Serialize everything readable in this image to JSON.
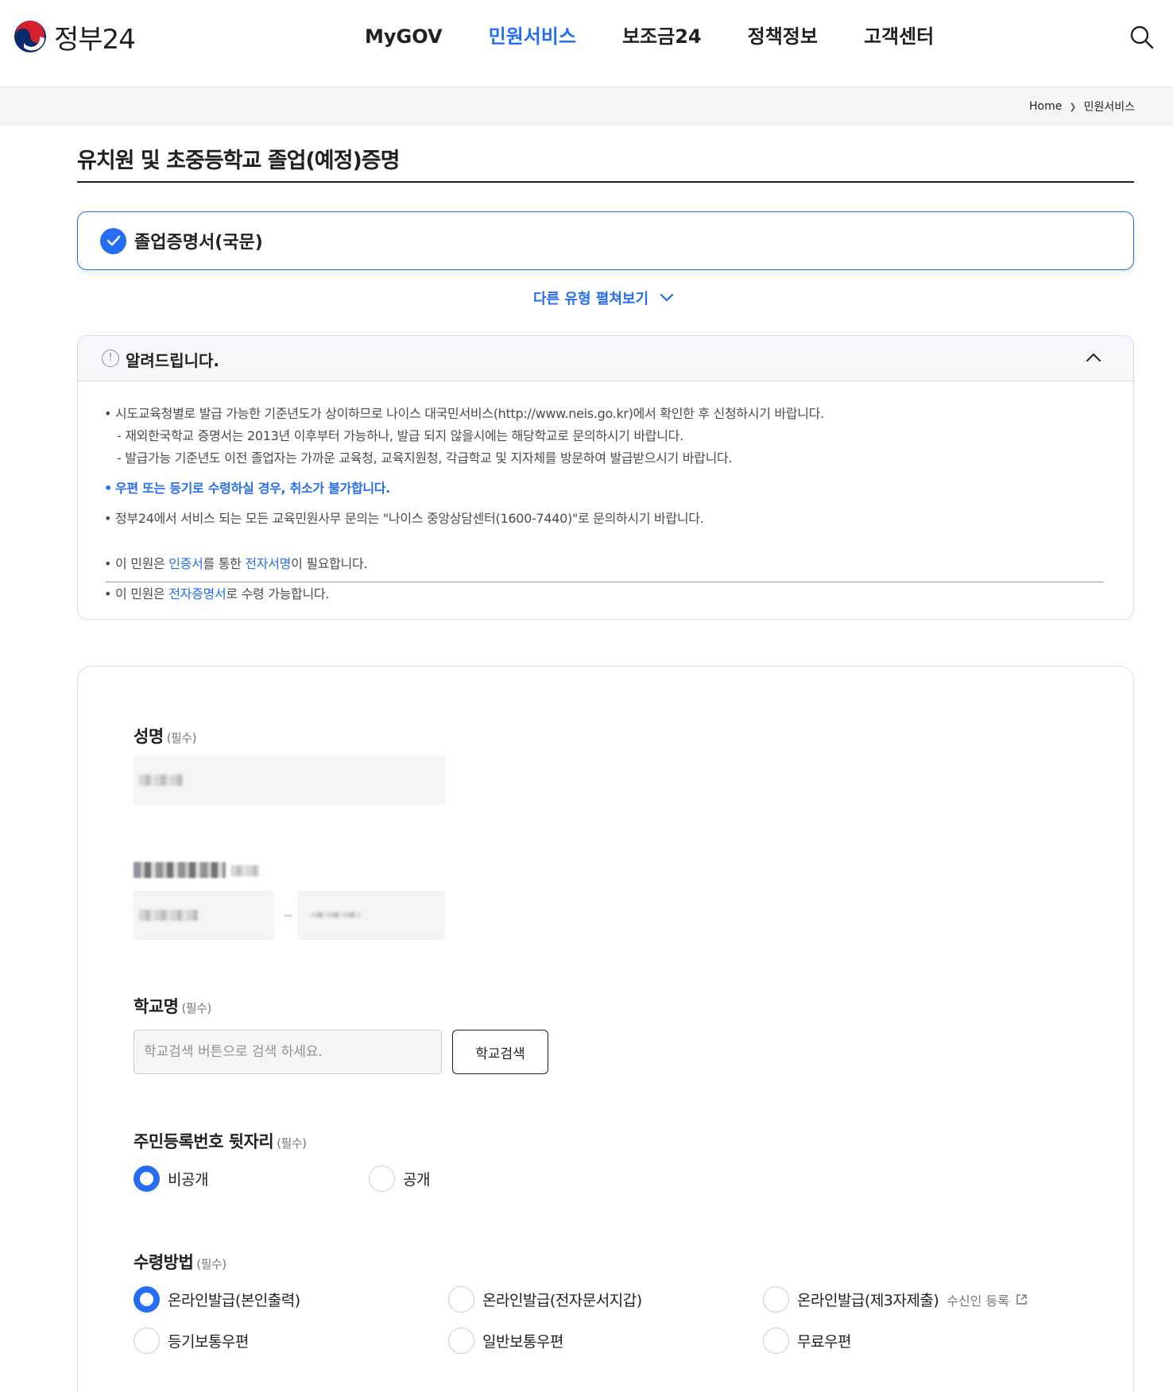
{
  "header": {
    "logo_text": "정부24",
    "nav": [
      "MyGOV",
      "민원서비스",
      "보조금24",
      "정책정보",
      "고객센터"
    ],
    "active_nav": "민원서비스"
  },
  "breadcrumb": {
    "home": "Home",
    "current": "민원서비스"
  },
  "page": {
    "title": "유치원 및 초중등학교 졸업(예정)증명"
  },
  "type_select": {
    "selected": "졸업증명서(국문)",
    "expand_label": "다른 유형 펼쳐보기"
  },
  "notice": {
    "title": "알려드립니다.",
    "line1": "시도교육청별로 발급 가능한 기준년도가 상이하므로 나이스 대국민서비스(http://www.neis.go.kr)에서 확인한 후 신청하시기 바랍니다.",
    "line2": "- 재외한국학교 증명서는 2013년 이후부터 가능하나, 발급 되지 않을시에는 해당학교로 문의하시기 바랍니다.",
    "line3": "- 발급가능 기준년도 이전 졸업자는 가까운 교육청, 교육지원청, 각급학교 및 지자체를 방문하여 발급받으시기 바랍니다.",
    "line4": "우편 또는 등기로 수령하실 경우, 취소가 불가합니다.",
    "line5": "정부24에서 서비스 되는 모든 교육민원사무 문의는 \"나이스 중앙상담센터(1600-7440)\"로 문의하시기 바랍니다.",
    "sign": {
      "pre": "이 민원은 ",
      "link1": "인증서",
      "mid": "를 통한 ",
      "link2": "전자서명",
      "post": "이 필요합니다."
    },
    "receive": {
      "pre": "이 민원은 ",
      "link": "전자증명서",
      "post": "로 수령 가능합니다."
    }
  },
  "form": {
    "required_tag": "(필수)",
    "name_label": "성명",
    "school_label": "학교명",
    "school_placeholder": "학교검색 버튼으로 검색 하세요.",
    "school_search_button": "학교검색",
    "rrn_label": "주민등록번호 뒷자리",
    "rrn_options": [
      "비공개",
      "공개"
    ],
    "rrn_selected": "비공개",
    "receipt_label": "수령방법",
    "receipt_options": [
      "온라인발급(본인출력)",
      "온라인발급(전자문서지갑)",
      "온라인발급(제3자제출)",
      "등기보통우편",
      "일반보통우편",
      "무료우편"
    ],
    "receipt_selected": "온라인발급(본인출력)",
    "recipient_register": "수신인 등록"
  },
  "colors": {
    "accent": "#256ef4",
    "text": "#1e2124",
    "border": "#d9dce0"
  },
  "icons": {
    "logo": "taegeuk-logo-icon",
    "search": "search-icon",
    "check": "check-icon",
    "chevron_down": "chevron-down-icon",
    "chevron_up": "chevron-up-icon",
    "info": "info-icon",
    "external": "external-link-icon"
  }
}
